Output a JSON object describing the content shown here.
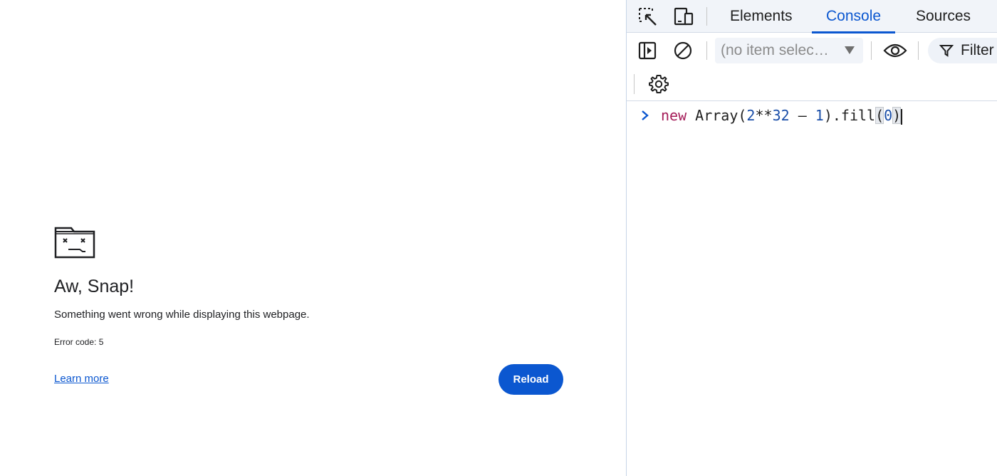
{
  "crash_page": {
    "title": "Aw, Snap!",
    "message": "Something went wrong while displaying this webpage.",
    "error_code": "Error code: 5",
    "learn_more": "Learn more",
    "reload": "Reload",
    "icon": "sad-tab-icon"
  },
  "devtools": {
    "tabs": [
      {
        "label": "Elements",
        "active": false
      },
      {
        "label": "Console",
        "active": true
      },
      {
        "label": "Sources",
        "active": false
      }
    ],
    "toolbar": {
      "context_placeholder": "(no item selec…",
      "filter_label": "Filter"
    },
    "console": {
      "input": {
        "keyword": "new",
        "callee": " Array(",
        "num1": "2",
        "op1": "**",
        "num2": "32",
        "op2": " – ",
        "num3": "1",
        "mid": ").fill",
        "open_paren": "(",
        "arg": "0",
        "close_paren": ")"
      }
    },
    "icons": {
      "inspect": "element-picker-icon",
      "device": "device-toolbar-icon",
      "sidebar": "sidebar-toggle-icon",
      "clear": "clear-console-icon",
      "eye": "live-expression-icon",
      "filter": "filter-icon",
      "settings": "gear-icon"
    },
    "accent_color": "#0b57d0"
  }
}
